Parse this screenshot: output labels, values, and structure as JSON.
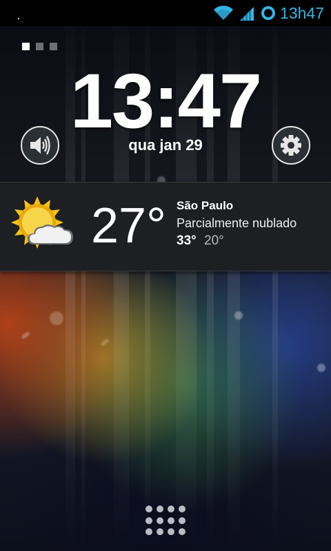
{
  "status_bar": {
    "time": "13h47",
    "accent_color": "#33b5e5",
    "icons": [
      "wifi-icon",
      "signal-icon",
      "sync-icon"
    ]
  },
  "home_pages": {
    "count": 3,
    "active": 0
  },
  "clock": {
    "time": "13:47",
    "date": "qua jan 29"
  },
  "buttons": {
    "left_icon": "speaker-icon",
    "right_icon": "gear-icon"
  },
  "weather": {
    "icon": "partly-cloudy-icon",
    "temperature": "27°",
    "city": "São Paulo",
    "condition": "Parcialmente nublado",
    "high": "33°",
    "low": "20°"
  },
  "dock": {
    "icon": "app-drawer-icon"
  }
}
